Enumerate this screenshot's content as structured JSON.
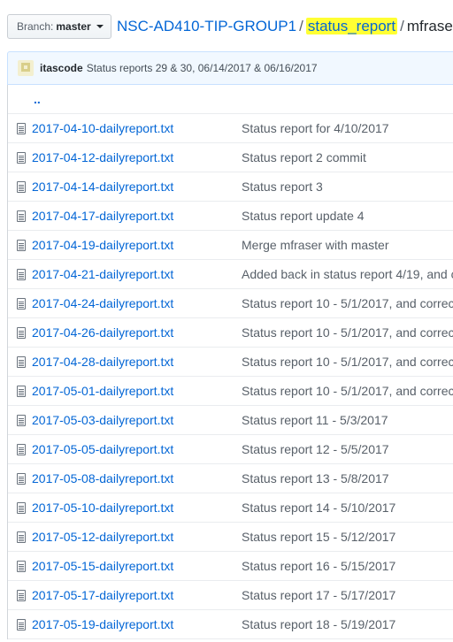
{
  "branch": {
    "prefix": "Branch:",
    "name": "master"
  },
  "breadcrumb": {
    "repo": "NSC-AD410-TIP-GROUP1",
    "folder": "status_report",
    "subfolder": "mfraser",
    "separator": "/"
  },
  "commit": {
    "author": "itascode",
    "message": "Status reports 29 & 30, 06/14/2017 & 06/16/2017"
  },
  "up_link": "..",
  "files": [
    {
      "name": "2017-04-10-dailyreport.txt",
      "message": "Status report for 4/10/2017"
    },
    {
      "name": "2017-04-12-dailyreport.txt",
      "message": "Status report 2 commit"
    },
    {
      "name": "2017-04-14-dailyreport.txt",
      "message": "Status report 3"
    },
    {
      "name": "2017-04-17-dailyreport.txt",
      "message": "Status report update 4"
    },
    {
      "name": "2017-04-19-dailyreport.txt",
      "message": "Merge mfraser with master"
    },
    {
      "name": "2017-04-21-dailyreport.txt",
      "message": "Added back in status report 4/19, and c"
    },
    {
      "name": "2017-04-24-dailyreport.txt",
      "message": "Status report 10 - 5/1/2017, and correc"
    },
    {
      "name": "2017-04-26-dailyreport.txt",
      "message": "Status report 10 - 5/1/2017, and correc"
    },
    {
      "name": "2017-04-28-dailyreport.txt",
      "message": "Status report 10 - 5/1/2017, and correc"
    },
    {
      "name": "2017-05-01-dailyreport.txt",
      "message": "Status report 10 - 5/1/2017, and correc"
    },
    {
      "name": "2017-05-03-dailyreport.txt",
      "message": "Status report 11 - 5/3/2017"
    },
    {
      "name": "2017-05-05-dailyreport.txt",
      "message": "Status report 12 - 5/5/2017"
    },
    {
      "name": "2017-05-08-dailyreport.txt",
      "message": "Status report 13 - 5/8/2017"
    },
    {
      "name": "2017-05-10-dailyreport.txt",
      "message": "Status report 14 - 5/10/2017"
    },
    {
      "name": "2017-05-12-dailyreport.txt",
      "message": "Status report 15 - 5/12/2017"
    },
    {
      "name": "2017-05-15-dailyreport.txt",
      "message": "Status report 16 - 5/15/2017"
    },
    {
      "name": "2017-05-17-dailyreport.txt",
      "message": "Status report 17 - 5/17/2017"
    },
    {
      "name": "2017-05-19-dailyreport.txt",
      "message": "Status report 18 - 5/19/2017"
    }
  ],
  "colors": {
    "link": "#0366d6",
    "highlight": "#ffff33",
    "commit_bar": "#f1f8ff"
  }
}
